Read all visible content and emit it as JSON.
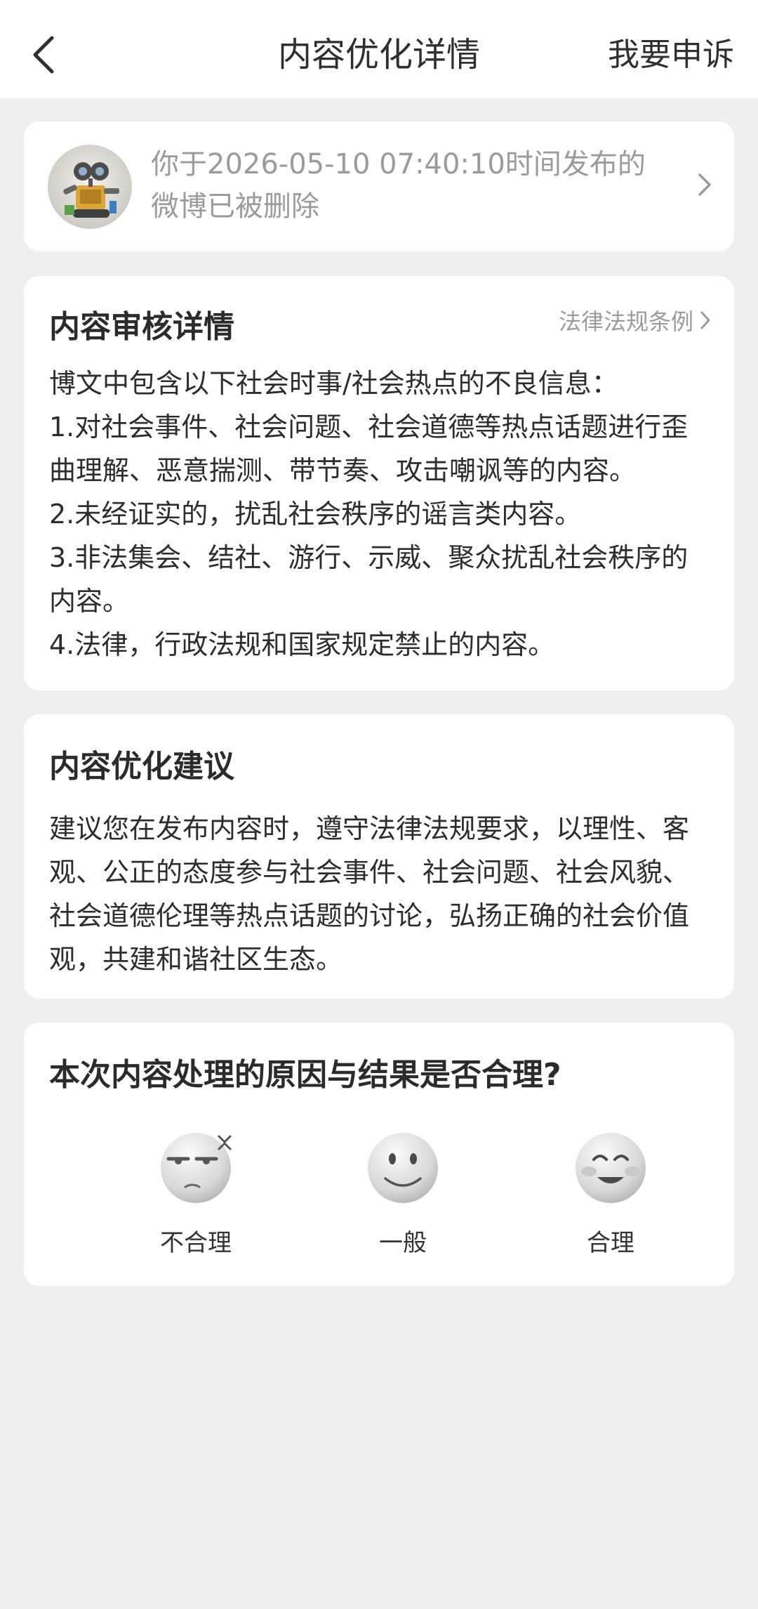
{
  "header": {
    "title": "内容优化详情",
    "appeal_label": "我要申诉",
    "back_icon": "chevron-left-icon"
  },
  "post": {
    "notice": "你于2026-05-10 07:40:10时间发布的微博已被删除",
    "avatar": "robot-avatar"
  },
  "review": {
    "title": "内容审核详情",
    "law_link_label": "法律法规条例",
    "lines": [
      "博文中包含以下社会时事/社会热点的不良信息：",
      "1.对社会事件、社会问题、社会道德等热点话题进行歪曲理解、恶意揣测、带节奏、攻击嘲讽等的内容。",
      "2.未经证实的，扰乱社会秩序的谣言类内容。",
      "3.非法集会、结社、游行、示威、聚众扰乱社会秩序的内容。",
      "4.法律，行政法规和国家规定禁止的内容。"
    ]
  },
  "advice": {
    "title": "内容优化建议",
    "text": "建议您在发布内容时，遵守法律法规要求，以理性、客观、公正的态度参与社会事件、社会问题、社会风貌、社会道德伦理等热点话题的讨论，弘扬正确的社会价值观，共建和谐社区生态。"
  },
  "rating": {
    "question": "本次内容处理的原因与结果是否合理?",
    "options": [
      {
        "label": "不合理",
        "icon": "annoyed-face-icon"
      },
      {
        "label": "一般",
        "icon": "neutral-face-icon"
      },
      {
        "label": "合理",
        "icon": "happy-face-icon"
      }
    ]
  },
  "colors": {
    "background": "#efefef",
    "card": "#ffffff",
    "muted_text": "#9b9b9b",
    "body_text": "#2d2d2d"
  }
}
